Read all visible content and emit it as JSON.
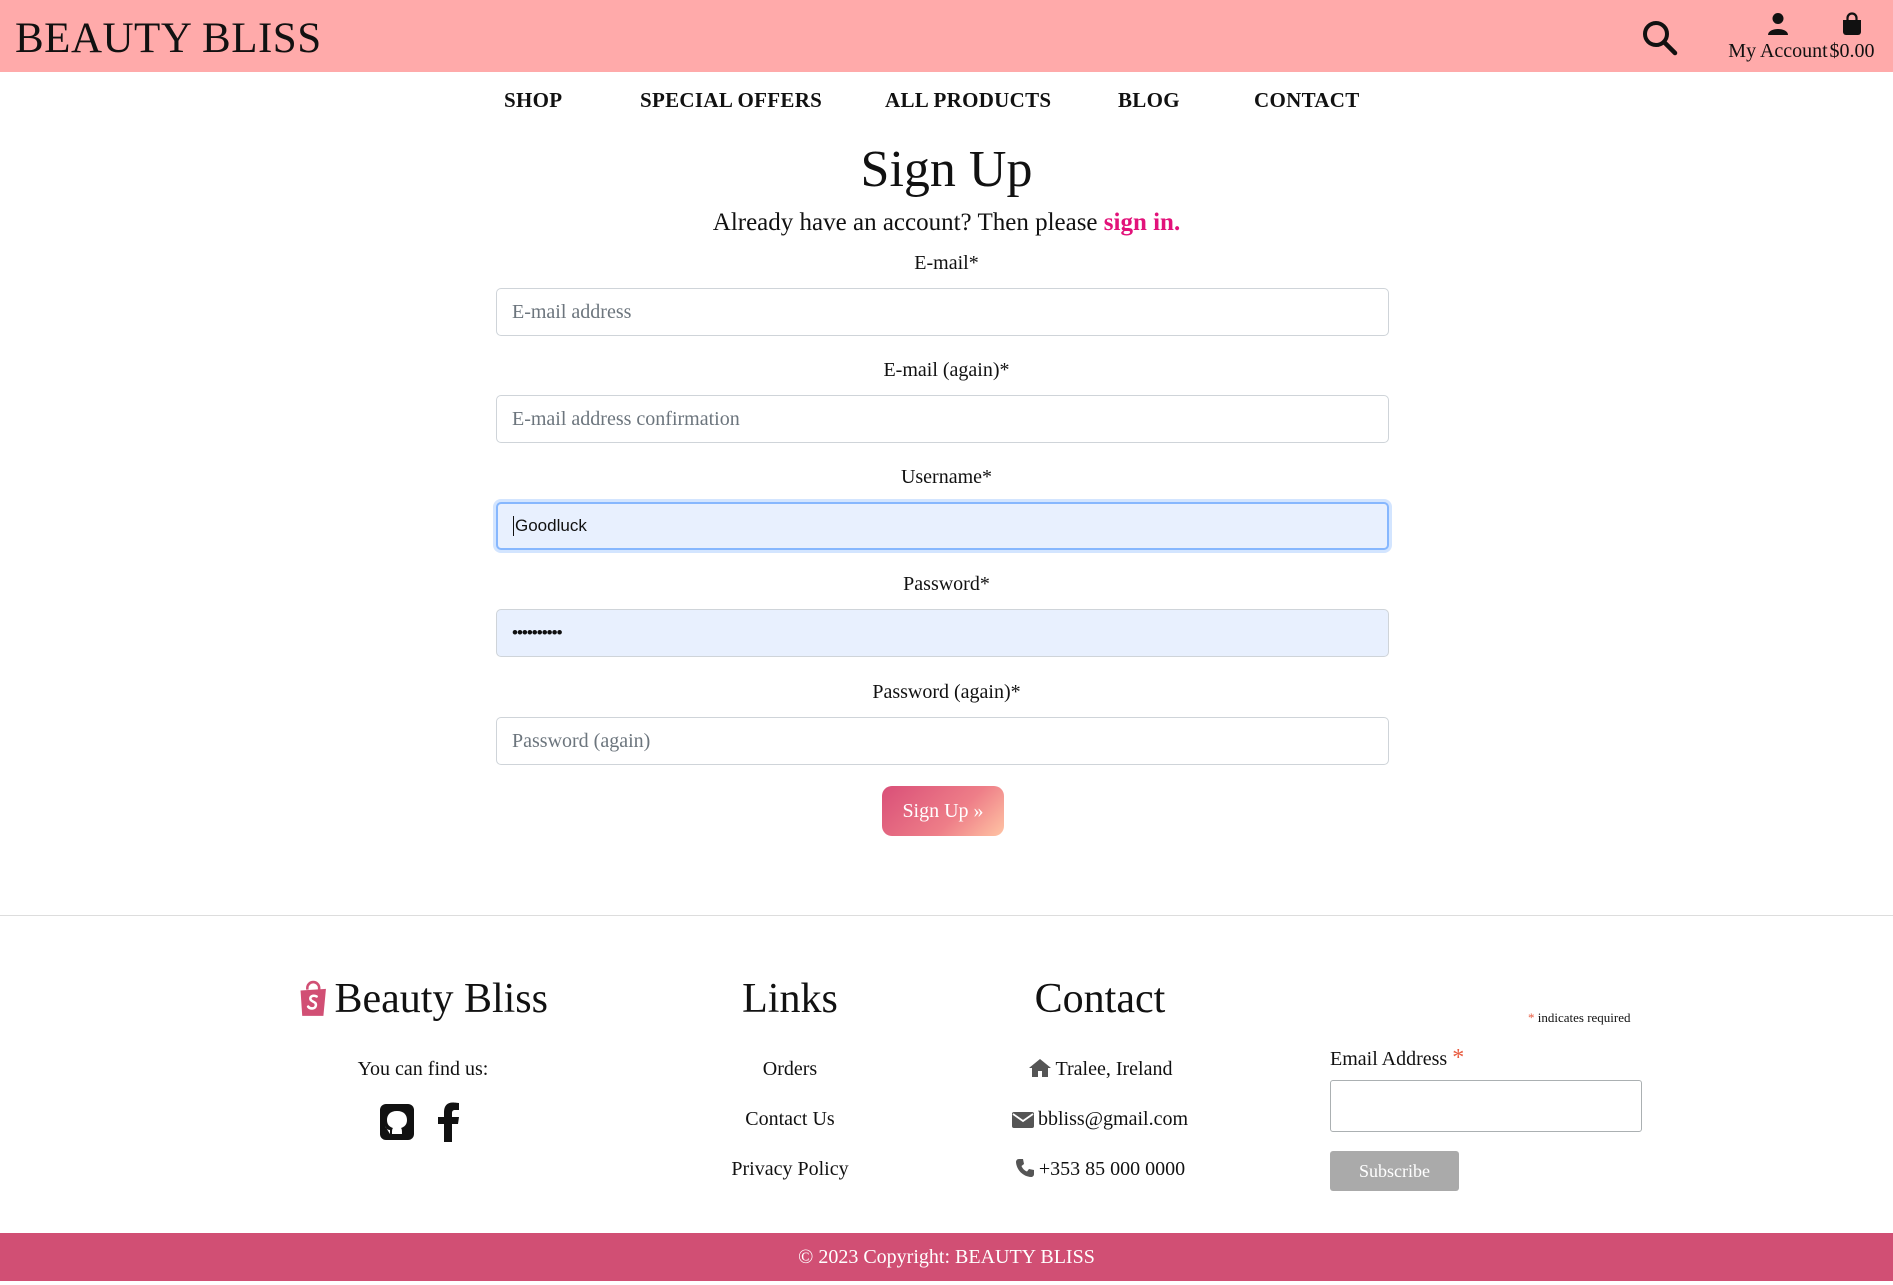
{
  "header": {
    "brand": "BEAUTY BLISS",
    "search_icon": "search-icon",
    "account_label": "My Account",
    "cart_total": "$0.00",
    "background_color": "#ffaaaa"
  },
  "nav": {
    "items": [
      {
        "label": "SHOP"
      },
      {
        "label": "SPECIAL OFFERS"
      },
      {
        "label": "ALL PRODUCTS"
      },
      {
        "label": "BLOG"
      },
      {
        "label": "CONTACT"
      }
    ]
  },
  "signup": {
    "title": "Sign Up",
    "subtitle_prefix": "Already have an account? Then please",
    "signin_link": "sign in.",
    "link_color": "#e2127a",
    "fields": [
      {
        "label": "E-mail*",
        "placeholder": "E-mail address",
        "value": ""
      },
      {
        "label": "E-mail (again)*",
        "placeholder": "E-mail address confirmation",
        "value": ""
      },
      {
        "label": "Username*",
        "placeholder": "",
        "value": "Goodluck"
      },
      {
        "label": "Password*",
        "placeholder": "",
        "value": "••••••••••"
      },
      {
        "label": "Password (again)*",
        "placeholder": "Password (again)",
        "value": ""
      }
    ],
    "submit_label": "Sign Up »"
  },
  "footer": {
    "brand": "Beauty Bliss",
    "find_us": "You can find us:",
    "social_icons": [
      "github-icon",
      "facebook-icon"
    ],
    "links_heading": "Links",
    "links": [
      "Orders",
      "Contact Us",
      "Privacy Policy"
    ],
    "contact_heading": "Contact",
    "contact": {
      "location": "Tralee, Ireland",
      "email": "bbliss@gmail.com",
      "phone": "+353 85 000 0000"
    },
    "newsletter": {
      "required_star": "*",
      "required_note": "indicates required",
      "email_label": "Email Address",
      "subscribe_label": "Subscribe"
    },
    "copyright": "© 2023 Copyright: BEAUTY BLISS",
    "copyright_color": "#d14f74"
  }
}
